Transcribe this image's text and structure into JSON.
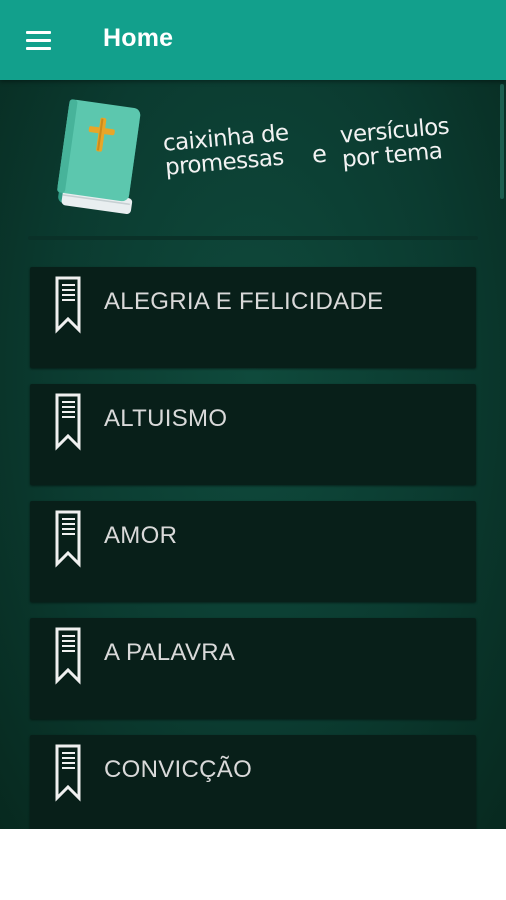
{
  "header": {
    "title": "Home",
    "menu_icon": "hamburger-menu-icon",
    "color": "#12a08c"
  },
  "banner": {
    "logo_icon": "bible-book-icon",
    "line1": "caixinha de",
    "line2": "promessas",
    "connector": "e",
    "line3": "versículos",
    "line4": "por tema"
  },
  "topics": [
    {
      "label": "ALEGRIA E FELICIDADE",
      "icon": "bookmark-icon"
    },
    {
      "label": "ALTUISMO",
      "icon": "bookmark-icon"
    },
    {
      "label": "AMOR",
      "icon": "bookmark-icon"
    },
    {
      "label": "A PALAVRA",
      "icon": "bookmark-icon"
    },
    {
      "label": "CONVICÇÃO",
      "icon": "bookmark-icon"
    }
  ],
  "colors": {
    "background": "#0b3b30",
    "card": "#081f19",
    "text": "#d9d9d9"
  }
}
